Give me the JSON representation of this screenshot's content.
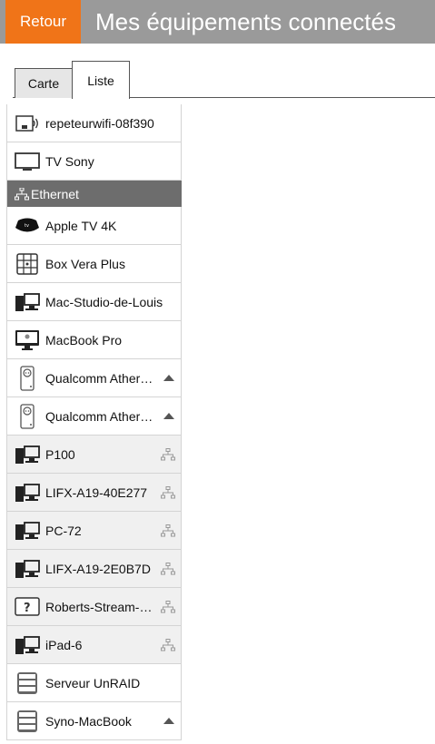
{
  "header": {
    "back_label": "Retour",
    "title": "Mes équipements connectés",
    "accent_color": "#f07418",
    "bar_color": "#9a9a9a"
  },
  "tabs": [
    {
      "label": "Carte",
      "active": false
    },
    {
      "label": "Liste",
      "active": true
    }
  ],
  "devices": {
    "wifi_tail": [
      {
        "label": "repeteurwifi-08f390",
        "icon": "wifi-repeater-icon"
      },
      {
        "label": "TV Sony",
        "icon": "tv-icon"
      }
    ],
    "ethernet_section": {
      "label": "Ethernet",
      "icon": "ethernet-icon"
    },
    "ethernet": [
      {
        "label": "Apple TV 4K",
        "icon": "apple-tv-icon"
      },
      {
        "label": "Box Vera Plus",
        "icon": "box-grid-icon"
      },
      {
        "label": "Mac-Studio-de-Louis",
        "icon": "desktop-computer-icon"
      },
      {
        "label": "MacBook Pro",
        "icon": "imac-icon"
      },
      {
        "label": "Qualcomm Ather…",
        "icon": "powerline-adapter-icon",
        "expand": "chevron-up-icon"
      },
      {
        "label": "Qualcomm Ather…",
        "icon": "powerline-adapter-icon",
        "expand": "chevron-up-icon"
      },
      {
        "label": "P100",
        "icon": "desktop-computer-icon",
        "status": "network-icon"
      },
      {
        "label": "LIFX-A19-40E277",
        "icon": "desktop-computer-icon",
        "status": "network-icon"
      },
      {
        "label": "PC-72",
        "icon": "desktop-computer-icon",
        "status": "network-icon"
      },
      {
        "label": "LIFX-A19-2E0B7D",
        "icon": "desktop-computer-icon",
        "status": "network-icon"
      },
      {
        "label": "Roberts-Stream-…",
        "icon": "unknown-device-icon",
        "status": "network-icon"
      },
      {
        "label": "iPad-6",
        "icon": "desktop-computer-icon",
        "status": "network-icon"
      },
      {
        "label": "Serveur UnRAID",
        "icon": "server-icon"
      },
      {
        "label": "Syno-MacBook",
        "icon": "server-icon",
        "expand": "chevron-up-icon"
      }
    ]
  }
}
